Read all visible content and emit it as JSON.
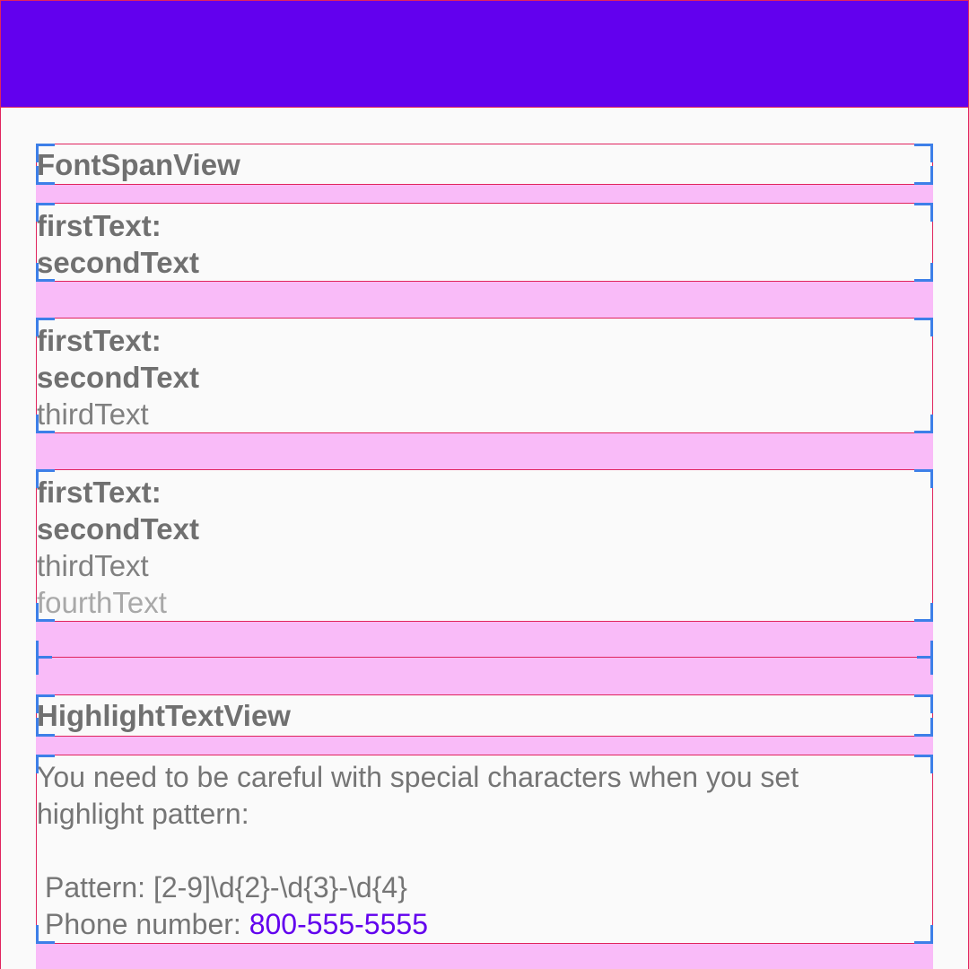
{
  "font_span_section": {
    "title": "FontSpanView",
    "example_1": {
      "first": "firstText:",
      "second": "secondText"
    },
    "example_2": {
      "first": "firstText:",
      "second": "secondText",
      "third": "thirdText"
    },
    "example_3": {
      "first": "firstText:",
      "second": "secondText",
      "third": "thirdText",
      "fourth": "fourthText"
    }
  },
  "highlight_section": {
    "title": "HighlightTextView",
    "description_line_1": "You need to be careful with special characters when you set",
    "description_line_2": "highlight pattern:",
    "pattern_label": "Pattern:",
    "pattern_value": "[2-9]\\d{2}-\\d{3}-\\d{4}",
    "phone_label": "Phone number:",
    "phone_value": "800-555-5555"
  },
  "colors": {
    "app_bar": "#6200ee",
    "highlight": "#6200ee",
    "layout_bounds_fill": "#f9bbf8",
    "layout_bounds_border": "#e0245e",
    "layout_corner_marks": "#3d7fe8"
  }
}
